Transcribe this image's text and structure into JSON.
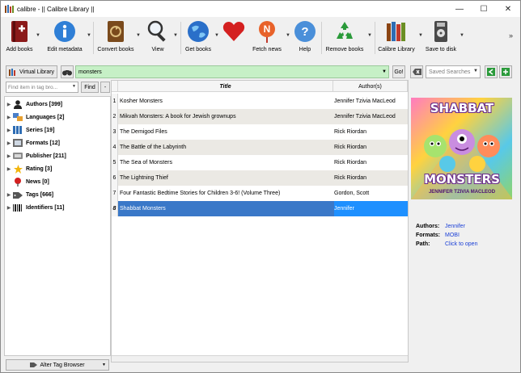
{
  "window": {
    "title": "calibre - || Calibre Library ||",
    "minimize": "—",
    "maximize": "☐",
    "close": "✕"
  },
  "toolbar": {
    "add_books": "Add books",
    "edit_metadata": "Edit metadata",
    "convert_books": "Convert books",
    "view": "View",
    "get_books": "Get books",
    "fetch_news": "Fetch news",
    "help": "Help",
    "remove_books": "Remove books",
    "calibre_library": "Calibre Library",
    "save_to_disk": "Save to disk",
    "overflow": "»"
  },
  "search": {
    "virtual_library": "Virtual Library",
    "query": "monsters",
    "go": "Go!",
    "saved_searches_placeholder": "Saved Searches"
  },
  "tag_browser": {
    "find_placeholder": "Find item in tag bro...",
    "find_button": "Find",
    "collapse_button": "-",
    "items": [
      {
        "label": "Authors [399]",
        "icon": "person-icon",
        "expandable": true
      },
      {
        "label": "Languages [2]",
        "icon": "languages-icon",
        "expandable": true
      },
      {
        "label": "Series [19]",
        "icon": "series-icon",
        "expandable": true
      },
      {
        "label": "Formats [12]",
        "icon": "formats-icon",
        "expandable": true
      },
      {
        "label": "Publisher [211]",
        "icon": "publisher-icon",
        "expandable": true
      },
      {
        "label": "Rating [3]",
        "icon": "star-icon",
        "expandable": true
      },
      {
        "label": "News [0]",
        "icon": "pin-icon",
        "expandable": false
      },
      {
        "label": "Tags [666]",
        "icon": "tags-icon",
        "expandable": true
      },
      {
        "label": "Identifiers [11]",
        "icon": "barcode-icon",
        "expandable": true
      }
    ],
    "alter_button": "Alter Tag Browser"
  },
  "book_table": {
    "columns": [
      "Title",
      "Author(s)"
    ],
    "rows": [
      {
        "num": "1",
        "title": "Kosher Monsters",
        "author": "Jennifer Tzivia MacLeod"
      },
      {
        "num": "2",
        "title": "Mikvah Monsters: A book for Jewish grownups",
        "author": "Jennifer Tzivia MacLeod"
      },
      {
        "num": "3",
        "title": "The Demigod Files",
        "author": "Rick Riordan"
      },
      {
        "num": "4",
        "title": "The Battle of the Labyrinth",
        "author": "Rick Riordan"
      },
      {
        "num": "5",
        "title": "The Sea of Monsters",
        "author": "Rick Riordan"
      },
      {
        "num": "6",
        "title": "The Lightning Thief",
        "author": "Rick Riordan"
      },
      {
        "num": "7",
        "title": "Four Fantastic Bedtime Stories for Children 3-6! (Volume Three)",
        "author": "Gordon, Scott"
      },
      {
        "num": "8",
        "title": "Shabbat Monsters",
        "author": "Jennifer"
      }
    ],
    "selected_index": 7
  },
  "book_details": {
    "cover_title_top": "SHABBAT",
    "cover_title_bottom": "MONSTERS",
    "cover_author": "JENNIFER TZIVIA MACLEOD",
    "authors_label": "Authors:",
    "authors_value": "Jennifer",
    "formats_label": "Formats:",
    "formats_value": "MOBI",
    "path_label": "Path:",
    "path_value": "Click to open"
  },
  "colors": {
    "search_bg": "#c6f0c6",
    "selected_row": "#3a78c8",
    "link": "#1a3fd6"
  }
}
